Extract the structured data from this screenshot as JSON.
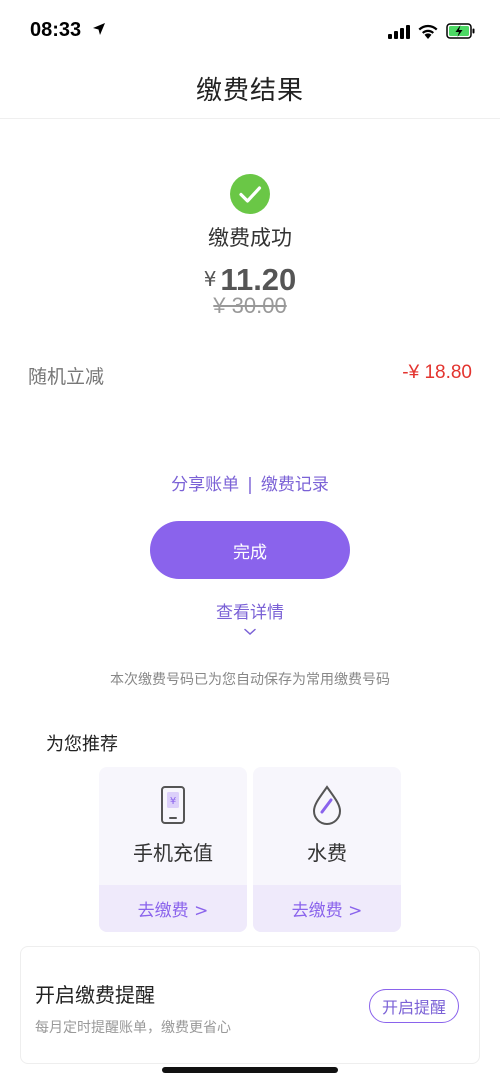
{
  "status_bar": {
    "time": "08:33"
  },
  "header": {
    "title": "缴费结果"
  },
  "result": {
    "status_text": "缴费成功",
    "currency_symbol": "¥",
    "paid_amount": "11.20",
    "original_amount": "¥ 30.00",
    "discount_label": "随机立减",
    "discount_value": "-¥ 18.80"
  },
  "links": {
    "share_bill": "分享账单",
    "separator": "|",
    "payment_records": "缴费记录",
    "view_details": "查看详情"
  },
  "done_button": {
    "label": "完成"
  },
  "saved_note": "本次缴费号码已为您自动保存为常用缴费号码",
  "recommendations": {
    "title": "为您推荐",
    "items": [
      {
        "label": "手机充值",
        "action": "去缴费 >",
        "icon": "phone-recharge-icon"
      },
      {
        "label": "水费",
        "action": "去缴费 >",
        "icon": "water-drop-icon"
      }
    ]
  },
  "reminder": {
    "title": "开启缴费提醒",
    "subtitle": "每月定时提醒账单，缴费更省心",
    "button_label": "开启提醒"
  },
  "colors": {
    "accent": "#8a63ec",
    "link": "#7b62d6",
    "success": "#6ac746",
    "discount": "#e3342f"
  }
}
